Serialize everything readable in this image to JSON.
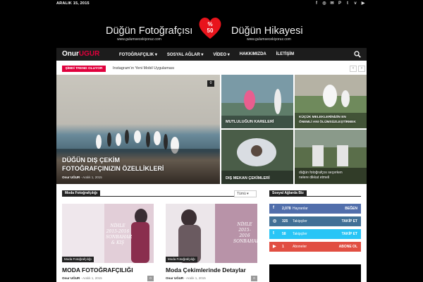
{
  "topbar": {
    "date": "ARALIK 15, 2015",
    "social_icons": [
      "facebook-icon",
      "instagram-icon",
      "mail-icon",
      "pinterest-icon",
      "twitter-icon",
      "vimeo-icon",
      "youtube-icon"
    ]
  },
  "logo": {
    "left_text": "Düğün Fotoğrafçısı",
    "right_text": "Düğün Hikayesi",
    "heart_top": "%",
    "heart_bottom": "50",
    "url_left": "www.gulumsecekiyoruz.com",
    "url_right": "www.gulumsecekiyoruz.com"
  },
  "nav": {
    "brand_a": "Onur",
    "brand_b": "UGUR",
    "items": [
      {
        "label": "FOTOĞRAFÇILIK ▾"
      },
      {
        "label": "SOSYAL AĞLAR ▾"
      },
      {
        "label": "VİDEO ▾"
      },
      {
        "label": "HAKKIMIZDA"
      },
      {
        "label": "İLETİŞİM"
      }
    ]
  },
  "trending": {
    "badge": "ŞİMDİ TREND OLUYOR",
    "text": "Instagram'ın Yeni Mobil Uygulaması",
    "prev": "‹",
    "next": "›"
  },
  "featured": {
    "main": {
      "title_line1": "DÜĞÜN DIŞ ÇEKİM",
      "title_line2": "FOTOĞRAFÇINIZIN ÖZELLİKLERİ",
      "author": "Onur UĞUR",
      "date": "Aralık 1, 2015",
      "count": "0"
    },
    "t1": {
      "title": "MUTLULUĞUN KARELERİ"
    },
    "t2": {
      "title_line1": "KÜÇÜK MELEKLERİNİZİN EN",
      "title_line2": "ÖNEMLİ ANI ÖLÜMSÜZLEŞTİRMEK"
    },
    "t3": {
      "title": "DIŞ MEKAN ÇEKİMLERİ"
    },
    "t4": {
      "title_line1": "düğün fotoğrafçısı seçerken",
      "title_line2": "nelere dikkat etmeli"
    }
  },
  "moda": {
    "section_title": "Moda Fotoğrafçılığı",
    "sort_label": "Tümü ▾",
    "cards": [
      {
        "category": "Moda Fotoğrafçılığı",
        "title": "MODA FOTOĞRAFÇILIĞI",
        "author": "Onur UĞUR",
        "date": "Aralık 1, 2015",
        "count": "0",
        "overlay1": "NİHLE",
        "overlay2": "2015-2016",
        "overlay3": "SONBAHAR & KIŞ"
      },
      {
        "category": "Moda Fotoğrafçılığı",
        "title": "Moda Çekimlerinde Detaylar",
        "author": "Onur UĞUR",
        "date": "Aralık 1, 2015",
        "count": "0",
        "overlay1": "NİHLE",
        "overlay2": "2015-2016",
        "overlay3": "SONBAHAR"
      }
    ]
  },
  "social": {
    "section_title": "Sosyal Ağlarda Biz",
    "rows": [
      {
        "icon": "f",
        "num": "2,078",
        "label": "Hayranlar",
        "action": "BEĞEN",
        "color": "#516eab"
      },
      {
        "icon": "◎",
        "num": "325",
        "label": "Takipçiler",
        "action": "TAKİP ET",
        "color": "#417096"
      },
      {
        "icon": "t",
        "num": "58",
        "label": "Takipçiler",
        "action": "TAKİP ET",
        "color": "#29c5f6"
      },
      {
        "icon": "▶",
        "num": "1",
        "label": "Aboneler",
        "action": "ABONE OL",
        "color": "#e14e42"
      }
    ]
  }
}
